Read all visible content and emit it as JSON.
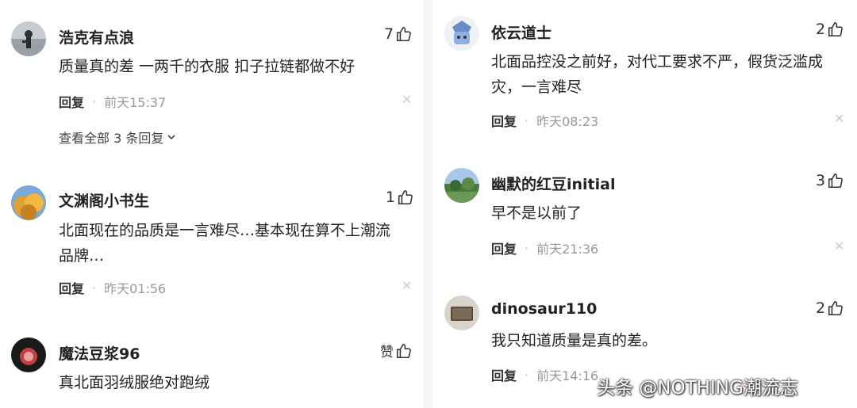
{
  "left_column": {
    "comments": [
      {
        "username": "浩克有点浪",
        "likes": "7",
        "content": "质量真的差 一两千的衣服 扣子拉链都做不好",
        "reply_label": "回复",
        "time": "前天15:37",
        "view_all": "查看全部 3 条回复"
      },
      {
        "username": "文渊阁小书生",
        "likes": "1",
        "content_line1": "北面现在的品质是一言难尽…基本现在算不上潮流",
        "content_line2": "品牌…",
        "reply_label": "回复",
        "time": "昨天01:56"
      },
      {
        "username": "魔法豆浆96",
        "likes": "赞",
        "content": "真北面羽绒服绝对跑绒"
      }
    ]
  },
  "right_column": {
    "comments": [
      {
        "username": "依云道士",
        "likes": "2",
        "content_line1": "北面品控没之前好，对代工要求不严，假货泛滥成",
        "content_line2": "灾，一言难尽",
        "reply_label": "回复",
        "time": "昨天08:23"
      },
      {
        "username": "幽默的红豆initial",
        "likes": "3",
        "content": "早不是以前了",
        "reply_label": "回复",
        "time": "前天21:36"
      },
      {
        "username": "dinosaur110",
        "likes": "2",
        "content": "我只知道质量是真的差。",
        "reply_label": "回复",
        "time": "前天14:16"
      }
    ]
  },
  "watermark": "头条 @NOTHING潮流志",
  "icons": {
    "like": "thumbs-up-icon",
    "close": "close-icon",
    "expand": "chevron-down-icon"
  },
  "colors": {
    "text": "#222222",
    "meta": "#999999",
    "divider": "#f6f6f6"
  }
}
